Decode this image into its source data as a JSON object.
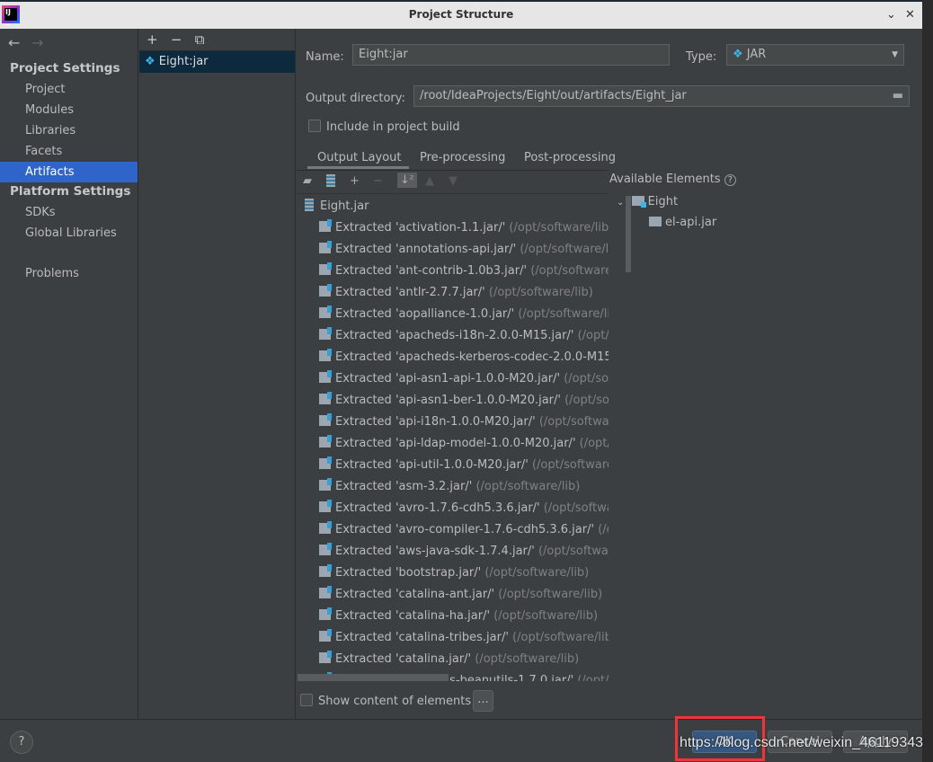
{
  "window": {
    "title": "Project Structure",
    "min_icon": "minimize-icon",
    "close_icon": "close-icon",
    "min": "⌄",
    "close": "✕"
  },
  "sidebar": {
    "back": "←",
    "forward": "→",
    "project_settings": "Project Settings",
    "project_items": [
      {
        "label": "Project"
      },
      {
        "label": "Modules"
      },
      {
        "label": "Libraries"
      },
      {
        "label": "Facets"
      },
      {
        "label": "Artifacts",
        "selected": true
      }
    ],
    "platform_settings": "Platform Settings",
    "platform_items": [
      {
        "label": "SDKs"
      },
      {
        "label": "Global Libraries"
      }
    ],
    "problems": "Problems"
  },
  "artifacts": {
    "add": "+",
    "remove": "−",
    "copy": "⧉",
    "items": [
      {
        "label": "Eight:jar"
      }
    ]
  },
  "form": {
    "name_label": "Name:",
    "name_value": "Eight:jar",
    "type_label": "Type:",
    "type_value": "JAR",
    "output_label": "Output directory:",
    "output_value": "/root/IdeaProjects/Eight/out/artifacts/Eight_jar",
    "include_label": "Include in project build",
    "include_checked": false
  },
  "tabs": [
    {
      "label": "Output Layout",
      "active": true
    },
    {
      "label": "Pre-processing"
    },
    {
      "label": "Post-processing"
    }
  ],
  "layout": {
    "root": "Eight.jar",
    "rows": [
      {
        "name": "Extracted 'activation-1.1.jar/'",
        "path": "(/opt/software/lib)"
      },
      {
        "name": "Extracted 'annotations-api.jar/'",
        "path": "(/opt/software/lib"
      },
      {
        "name": "Extracted 'ant-contrib-1.0b3.jar/'",
        "path": "(/opt/software/li"
      },
      {
        "name": "Extracted 'antlr-2.7.7.jar/'",
        "path": "(/opt/software/lib)"
      },
      {
        "name": "Extracted 'aopalliance-1.0.jar/'",
        "path": "(/opt/software/lib)"
      },
      {
        "name": "Extracted 'apacheds-i18n-2.0.0-M15.jar/'",
        "path": "(/opt/sof"
      },
      {
        "name": "Extracted 'apacheds-kerberos-codec-2.0.0-M15.jar",
        "path": ""
      },
      {
        "name": "Extracted 'api-asn1-api-1.0.0-M20.jar/'",
        "path": "(/opt/softw"
      },
      {
        "name": "Extracted 'api-asn1-ber-1.0.0-M20.jar/'",
        "path": "(/opt/softw"
      },
      {
        "name": "Extracted 'api-i18n-1.0.0-M20.jar/'",
        "path": "(/opt/software/"
      },
      {
        "name": "Extracted 'api-ldap-model-1.0.0-M20.jar/'",
        "path": "(/opt/so"
      },
      {
        "name": "Extracted 'api-util-1.0.0-M20.jar/'",
        "path": "(/opt/software/li"
      },
      {
        "name": "Extracted 'asm-3.2.jar/'",
        "path": "(/opt/software/lib)"
      },
      {
        "name": "Extracted 'avro-1.7.6-cdh5.3.6.jar/'",
        "path": "(/opt/software,"
      },
      {
        "name": "Extracted 'avro-compiler-1.7.6-cdh5.3.6.jar/'",
        "path": "(/opt"
      },
      {
        "name": "Extracted 'aws-java-sdk-1.7.4.jar/'",
        "path": "(/opt/software/l"
      },
      {
        "name": "Extracted 'bootstrap.jar/'",
        "path": "(/opt/software/lib)"
      },
      {
        "name": "Extracted 'catalina-ant.jar/'",
        "path": "(/opt/software/lib)"
      },
      {
        "name": "Extracted 'catalina-ha.jar/'",
        "path": "(/opt/software/lib)"
      },
      {
        "name": "Extracted 'catalina-tribes.jar/'",
        "path": "(/opt/software/lib)"
      },
      {
        "name": "Extracted 'catalina.jar/'",
        "path": "(/opt/software/lib)"
      },
      {
        "name": "Extracted 'commons-beanutils-1.7.0.jar/'",
        "path": "(/opt/so"
      }
    ],
    "show_content_label": "Show content of elements",
    "more": "..."
  },
  "available": {
    "title": "Available Elements",
    "help": "?",
    "module": "Eight",
    "jars": [
      "el-api.jar"
    ]
  },
  "footer": {
    "help": "?",
    "ok": "OK",
    "cancel": "Cancel",
    "apply": "Apply"
  },
  "watermark": {
    "text": "https://blog.csdn.net/weixin_461",
    "tail": "19343"
  },
  "colors": {
    "accent": "#2f65ca",
    "ok_button": "#365880",
    "highlight_box": "#f0353a"
  }
}
